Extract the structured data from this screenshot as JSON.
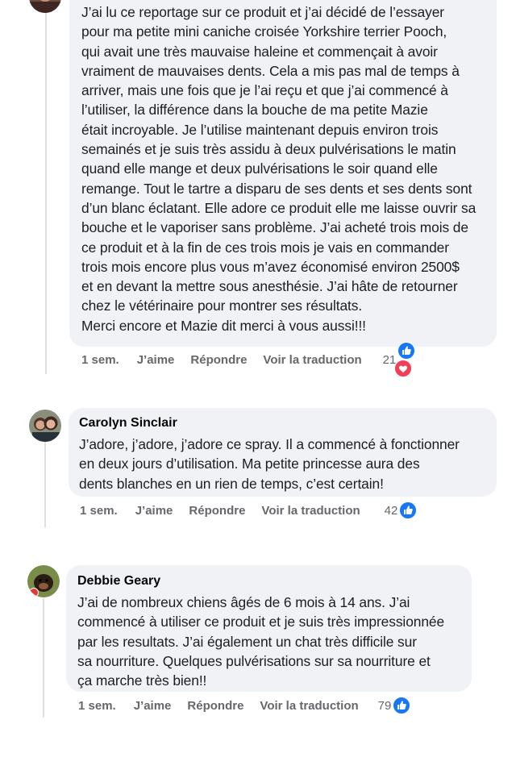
{
  "comments": [
    {
      "author": "",
      "text": "J’ai lu ce reportage sur ce produit et j’ai décidé de l’essayer\npour ma petite mini caniche croisée Yorkshire terrier Pooch,\nqui avait une très mauvaise haleine et commençait à avoir\nvraiment de mauvaises dents. Cela a mis pas mal de temps à\narriver, mais une fois que je l’ai reçu et que j’ai commencé à\nl’utiliser, la différence dans la bouche de ma petite Mazie\nétait incroyable. Je l’utilise maintenant depuis environ trois\nsemainés et je suis très assidu à deux pulvérisations le matin\nquand elle mange et deux pulvérisations le soir quand elle\nremange. Tout le tartre a disparu de ses dents et ses dents sont\nd’un blanc éclatant. Elle adore ce produit elle me laisse ouvrir sa\nbouche et le vaporiser sans problème. J’ai acheté trois mois de\nce produit et à la fin de ces trois mois je vais en commander\ntrois mois encore plus vous m’avez économisé environ 2500$\net en devant la mettre sous anesthésie. J’ai hâte de retourner\nchez le vétérinaire pour montrer ses résultats.\nMerci encore et Mazie dit merci à vous aussi!!!",
      "time": "1 sem.",
      "like": "J’aime",
      "reply": "Répondre",
      "translate": "Voir la traduction",
      "reactions": "21",
      "reaction_icons": [
        "like-icon",
        "love-icon"
      ]
    },
    {
      "author": "Carolyn Sinclair",
      "text": "J’adore, j’adore, j’adore ce spray. Il a commencé à fonctionner\nen deux jours d’utilisation. Ma petite princesse aura des\ndents blanches en un rien de temps, c’est certain!",
      "time": "1 sem.",
      "like": "J’aime",
      "reply": "Répondre",
      "translate": "Voir la traduction",
      "reactions": "42",
      "reaction_icons": [
        "like-icon"
      ]
    },
    {
      "author": "Debbie Geary",
      "text": "J’ai de nombreux chiens âgés de 6 mois à 14 ans. J’ai\ncommencé à utiliser ce produit et je suis très impressionnée\npar les resultats. J’ai également un chat très difficile sur\nsa nourriture. Quelques pulvérisations sur sa nourriture et\nça marche très bien!!",
      "time": "1 sem.",
      "like": "J’aime",
      "reply": "Répondre",
      "translate": "Voir la traduction",
      "reactions": "79",
      "reaction_icons": [
        "like-icon"
      ]
    }
  ],
  "colors": {
    "bubble": "#f0f2f5",
    "like_blue": "#1877f2",
    "love_red": "#f33e58",
    "meta_gray": "#65676b"
  }
}
